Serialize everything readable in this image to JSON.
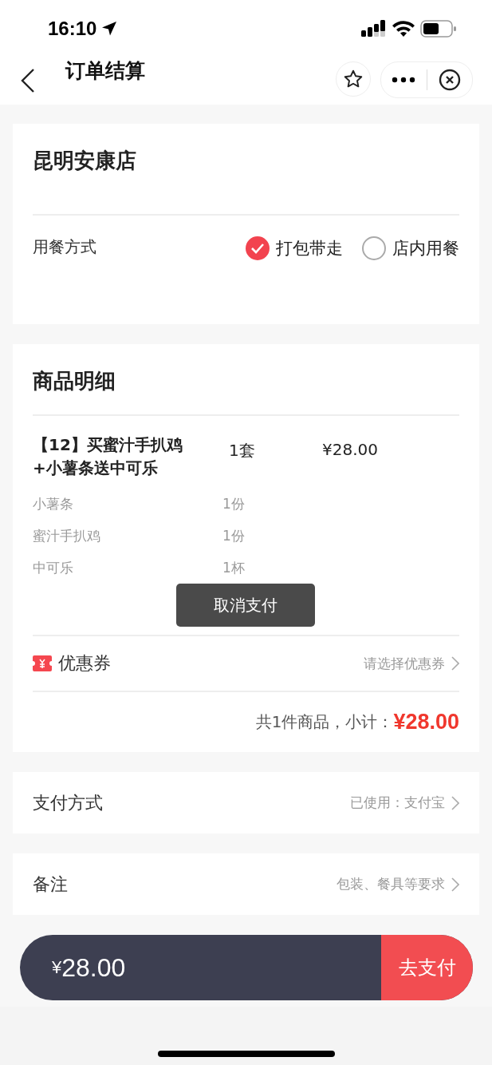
{
  "status_bar": {
    "time": "16:10"
  },
  "nav": {
    "title": "订单结算"
  },
  "store": {
    "name": "昆明安康店",
    "dining": {
      "label": "用餐方式",
      "options": [
        {
          "label": "打包带走",
          "selected": true
        },
        {
          "label": "店内用餐",
          "selected": false
        }
      ]
    }
  },
  "details": {
    "title": "商品明细",
    "items": [
      {
        "name": "【12】买蜜汁手扒鸡+小薯条送中可乐",
        "qty": "1套",
        "price": "¥28.00",
        "children": [
          {
            "name": "小薯条",
            "qty": "1份"
          },
          {
            "name": "蜜汁手扒鸡",
            "qty": "1份"
          },
          {
            "name": "中可乐",
            "qty": "1杯"
          }
        ]
      }
    ],
    "coupon": {
      "label": "优惠券",
      "value": "请选择优惠券"
    },
    "subtotal": {
      "label": "共1件商品，小计：",
      "amount": "¥28.00"
    }
  },
  "toast": "取消支付",
  "payment": {
    "label": "支付方式",
    "value": "已使用：支付宝"
  },
  "note": {
    "label": "备注",
    "value": "包装、餐具等要求"
  },
  "footer": {
    "currency": "¥",
    "amount": "28.00",
    "button": "去支付"
  }
}
